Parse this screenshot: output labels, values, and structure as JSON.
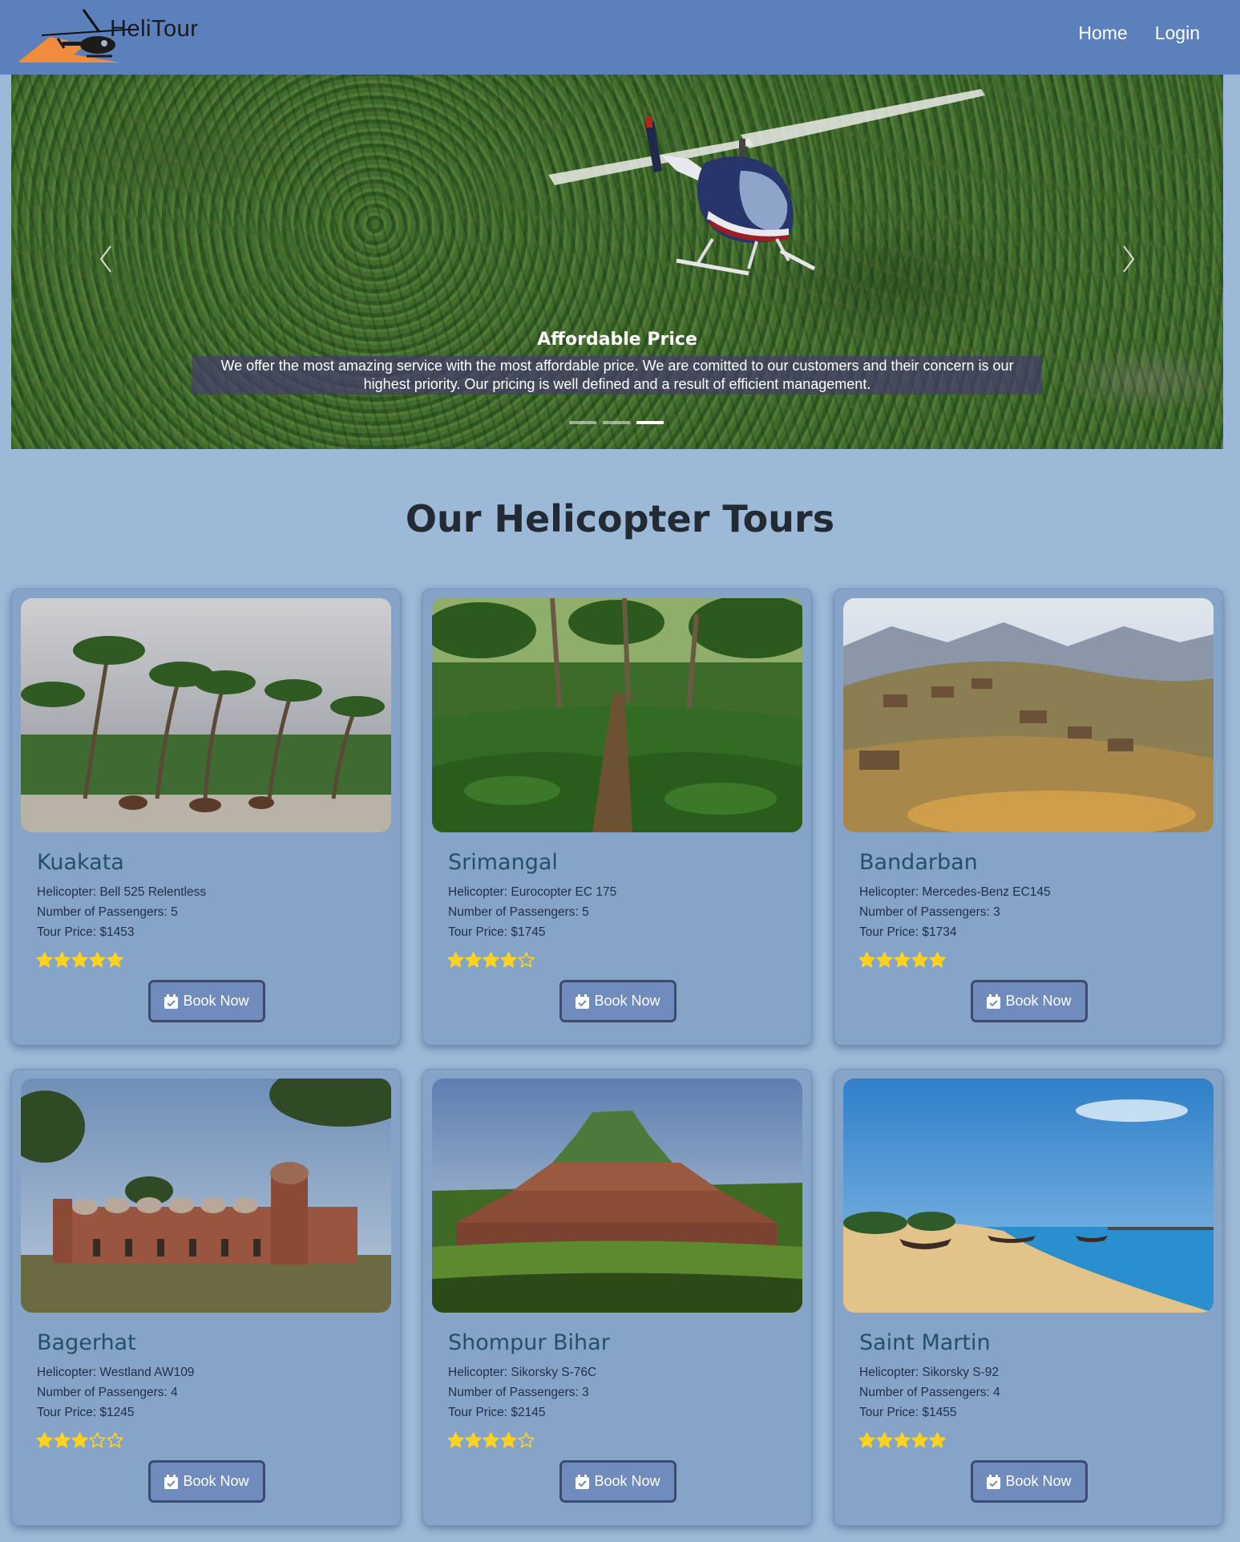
{
  "navbar": {
    "brand": "HeliTour",
    "links": [
      {
        "label": "Home"
      },
      {
        "label": "Login"
      }
    ]
  },
  "carousel": {
    "slide_count": 3,
    "active_slide": 3,
    "caption_title": "Affordable Price",
    "caption_text": "We offer the most amazing service with the most affordable price. We are comitted to our customers and their concern is our highest priority. Our pricing is well defined and a result of efficient management."
  },
  "section": {
    "title": "Our Helicopter Tours"
  },
  "tours": [
    {
      "name": "Kuakata",
      "helicopter": "Helicopter: Bell 525 Relentless",
      "passengers": "Number of Passengers: 5",
      "price": "Tour Price: $1453",
      "rating": 5,
      "button": "Book Now"
    },
    {
      "name": "Srimangal",
      "helicopter": "Helicopter: Eurocopter EC 175",
      "passengers": "Number of Passengers: 5",
      "price": "Tour Price: $1745",
      "rating": 4,
      "button": "Book Now"
    },
    {
      "name": "Bandarban",
      "helicopter": "Helicopter: Mercedes-Benz EC145",
      "passengers": "Number of Passengers: 3",
      "price": "Tour Price: $1734",
      "rating": 5,
      "button": "Book Now"
    },
    {
      "name": "Bagerhat",
      "helicopter": "Helicopter: Westland AW109",
      "passengers": "Number of Passengers: 4",
      "price": "Tour Price: $1245",
      "rating": 3,
      "button": "Book Now"
    },
    {
      "name": "Shompur Bihar",
      "helicopter": "Helicopter: Sikorsky S-76C",
      "passengers": "Number of Passengers: 3",
      "price": "Tour Price: $2145",
      "rating": 4,
      "button": "Book Now"
    },
    {
      "name": "Saint Martin",
      "helicopter": "Helicopter: Sikorsky S-92",
      "passengers": "Number of Passengers: 4",
      "price": "Tour Price: $1455",
      "rating": 5,
      "button": "Book Now"
    }
  ],
  "colors": {
    "navbar": "#5c80bc",
    "page_bg": "#9db9d8",
    "card_bg": "#86a3c8",
    "star": "#ffd21f",
    "button_bg": "#6f8cbd",
    "button_border": "#3c4a6c"
  },
  "icons": {
    "logo": "helicopter-logo-icon",
    "prev": "chevron-left-icon",
    "next": "chevron-right-icon",
    "star_full": "star-filled-icon",
    "star_empty": "star-outline-icon",
    "book": "calendar-check-icon"
  }
}
